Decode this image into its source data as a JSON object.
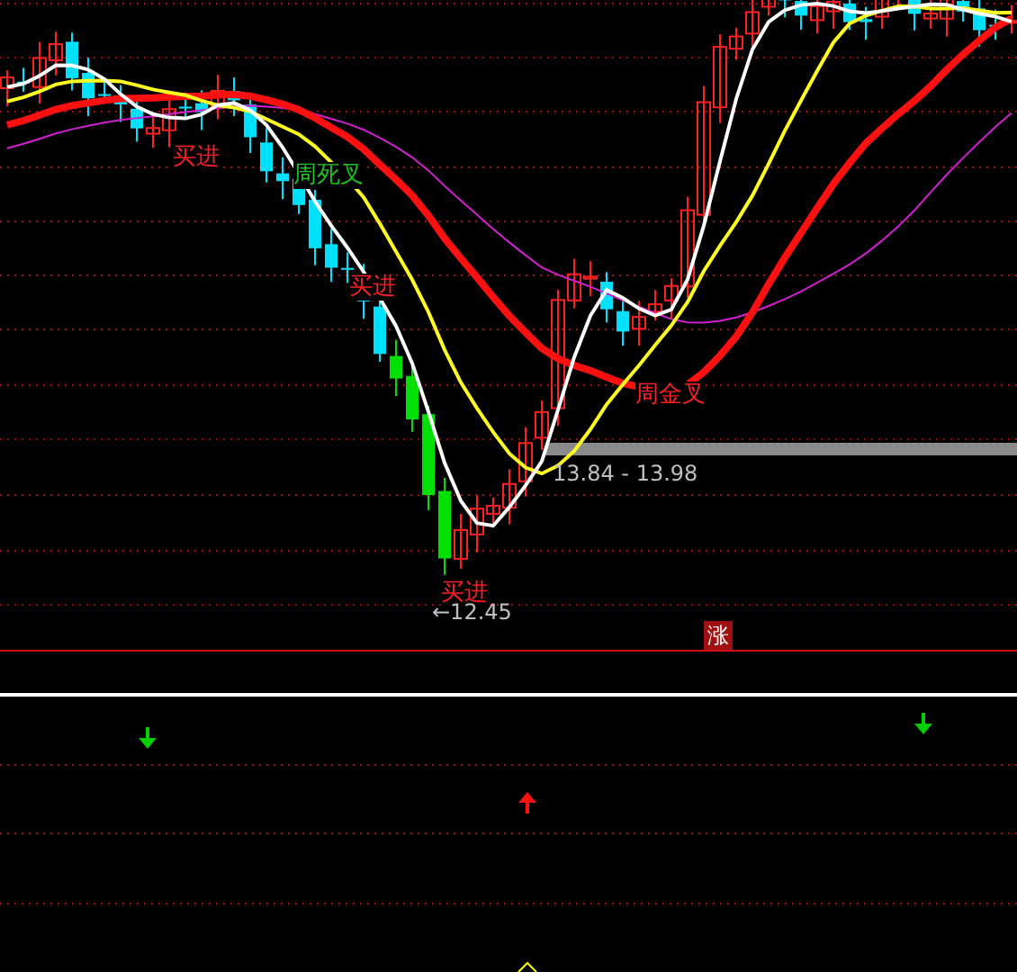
{
  "chart": {
    "signals": [
      {
        "kind": "buy",
        "label": "买进"
      },
      {
        "kind": "death_cross",
        "label": "周死叉"
      },
      {
        "kind": "buy",
        "label": "买进"
      },
      {
        "kind": "golden_cross",
        "label": "周金叉"
      },
      {
        "kind": "buy",
        "label": "买进"
      }
    ],
    "price_range": "13.84 - 13.98",
    "low_marker": "←12.45",
    "badge": "涨"
  },
  "indicator": {
    "arrows": [
      {
        "kind": "down"
      },
      {
        "kind": "up"
      },
      {
        "kind": "down"
      }
    ]
  }
}
